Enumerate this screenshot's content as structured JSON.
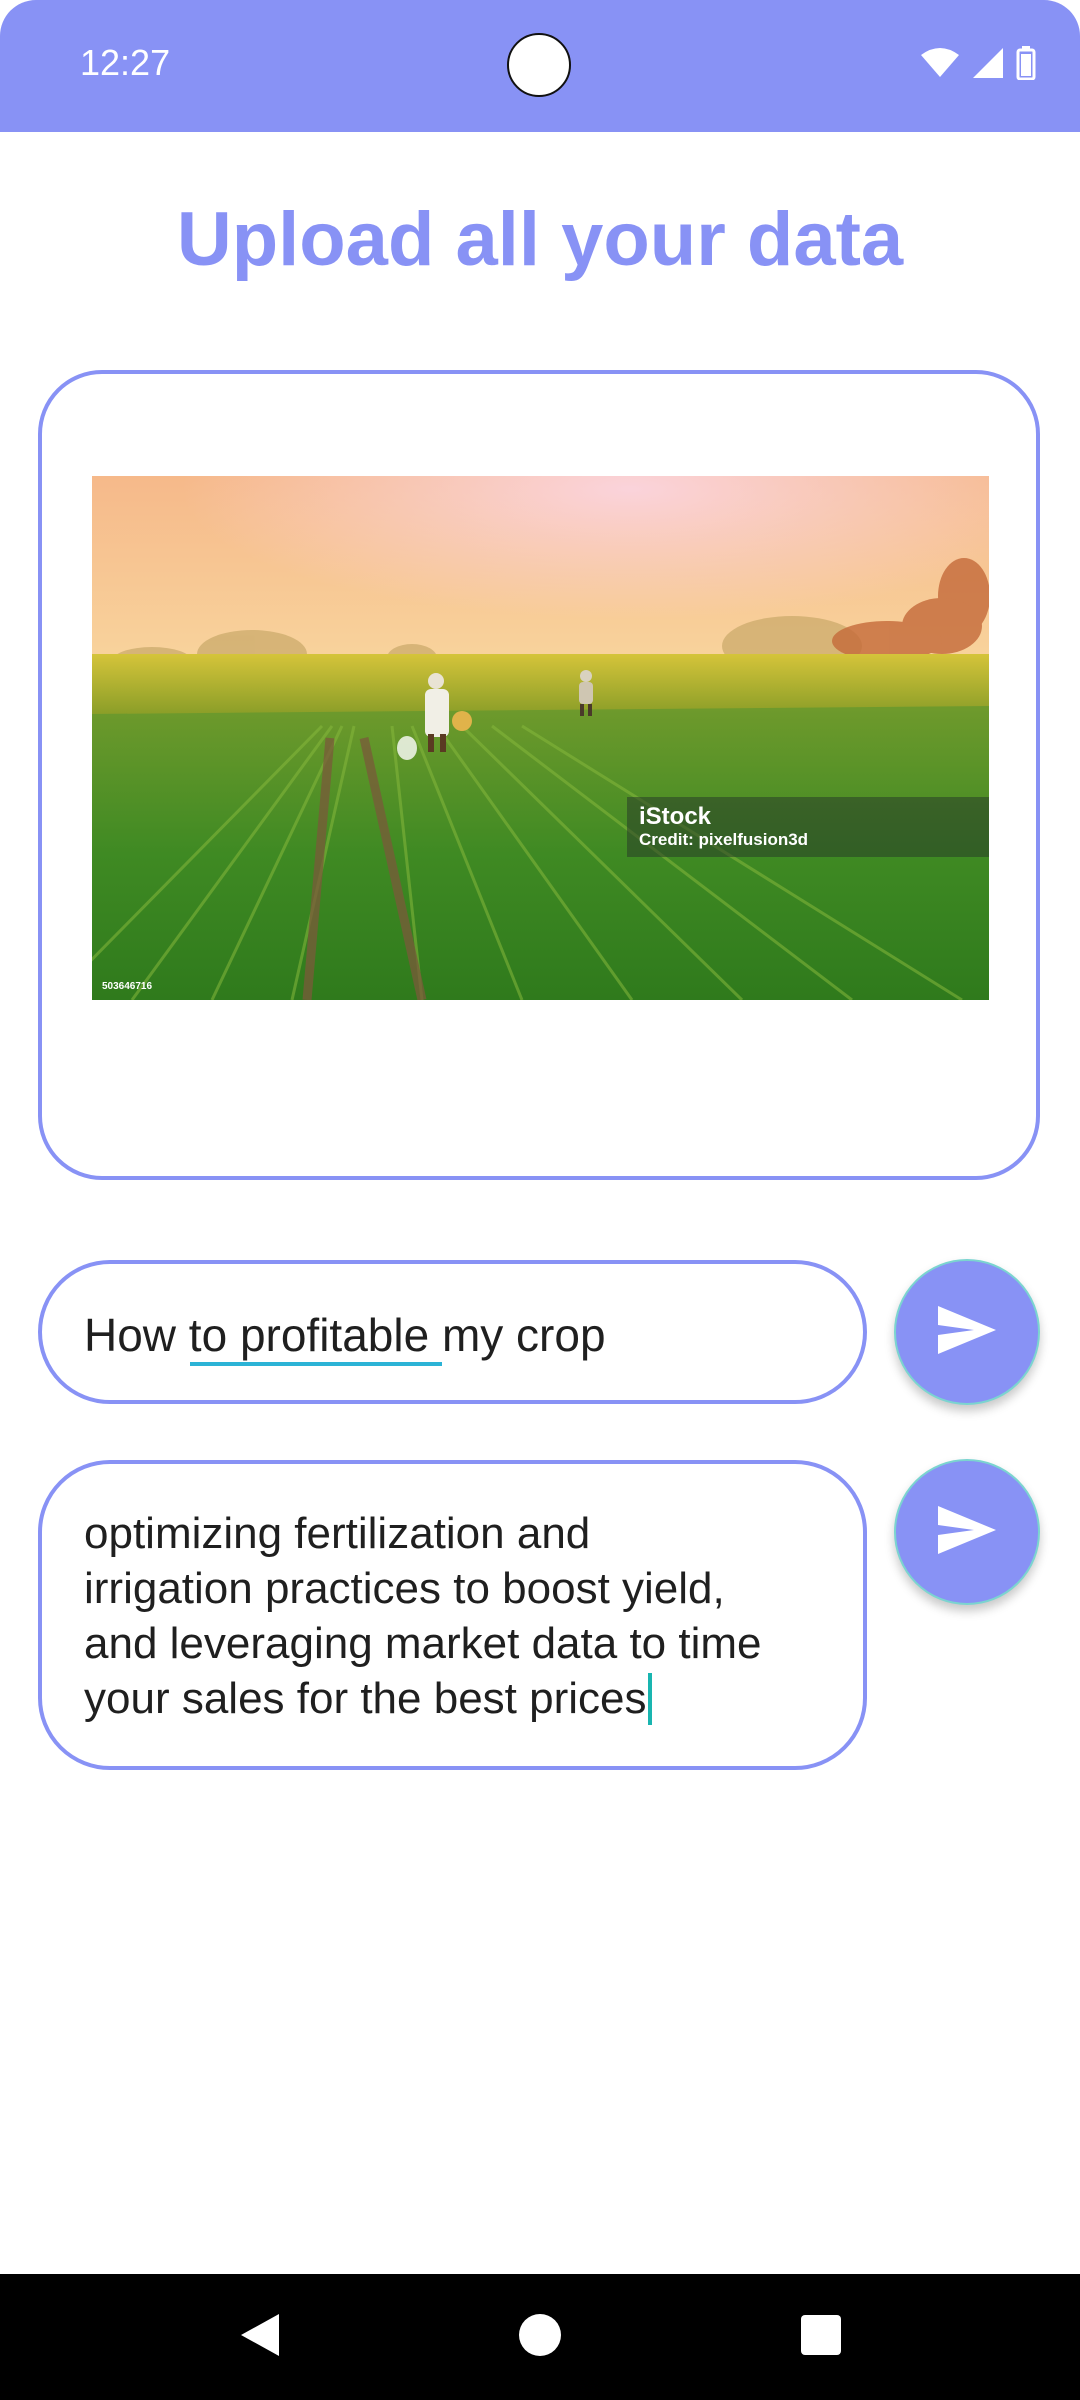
{
  "status_bar": {
    "time": "12:27",
    "icons": [
      "wifi-icon",
      "signal-icon",
      "battery-icon"
    ]
  },
  "header": {
    "title": "Upload all your data"
  },
  "upload_card": {
    "image": {
      "watermark_brand": "iStock",
      "watermark_credit": "Credit: pixelfusion3d",
      "stock_id": "503646716"
    }
  },
  "query": {
    "value": "How to profitable my crop",
    "send_icon": "send-icon"
  },
  "answer": {
    "lines": [
      "optimizing fertilization and",
      "irrigation practices to boost yield,",
      "and leveraging market data to time",
      "your sales for the best prices"
    ],
    "send_icon": "send-icon"
  },
  "nav": {
    "icons": [
      "back-icon",
      "home-icon",
      "recents-icon"
    ]
  },
  "colors": {
    "accent": "#8892f5",
    "cursor": "#19b5b0",
    "spellcheck": "#2bb3d6"
  }
}
